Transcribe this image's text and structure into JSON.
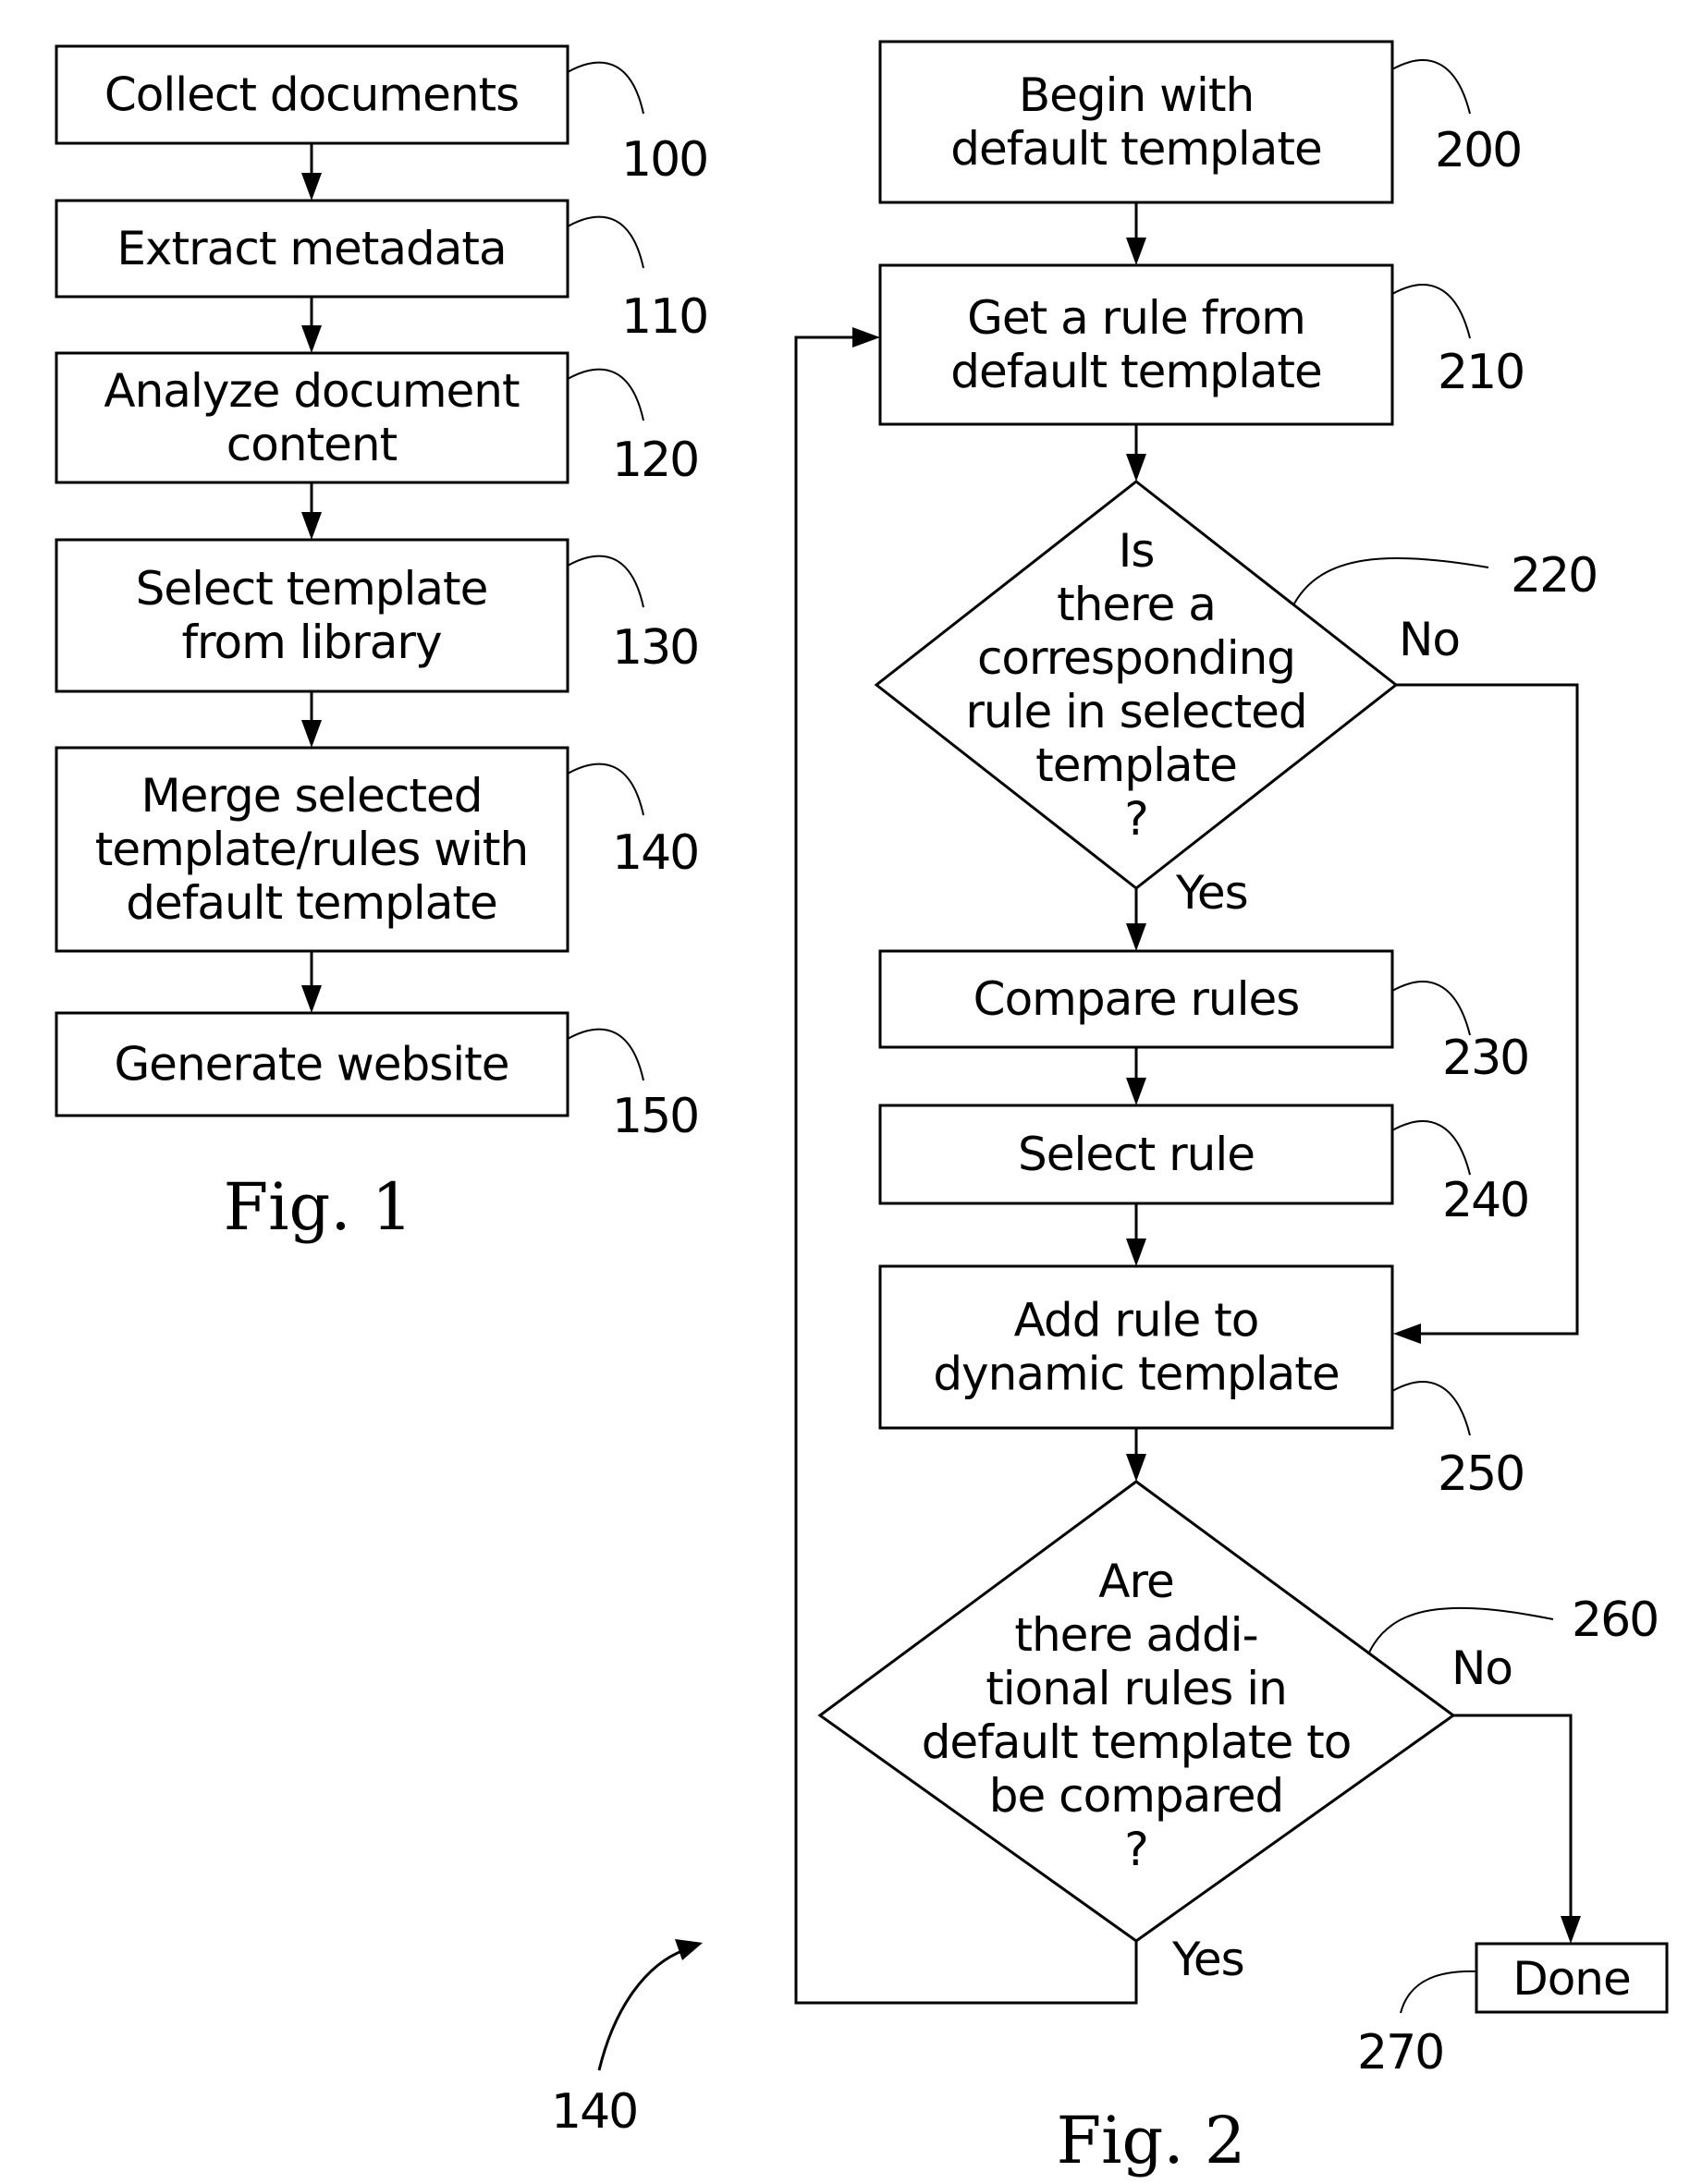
{
  "figure1": {
    "caption": "Fig. 1",
    "steps": [
      {
        "ref": "100",
        "lines": [
          "Collect documents"
        ]
      },
      {
        "ref": "110",
        "lines": [
          "Extract metadata"
        ]
      },
      {
        "ref": "120",
        "lines": [
          "Analyze document",
          "content"
        ]
      },
      {
        "ref": "130",
        "lines": [
          "Select template",
          "from library"
        ]
      },
      {
        "ref": "140",
        "lines": [
          "Merge selected",
          "template/rules with",
          "default template"
        ]
      },
      {
        "ref": "150",
        "lines": [
          "Generate website"
        ]
      }
    ]
  },
  "figure2": {
    "caption": "Fig. 2",
    "overall_ref": "140",
    "nodes": {
      "n200": {
        "ref": "200",
        "type": "process",
        "lines": [
          "Begin with",
          "default template"
        ]
      },
      "n210": {
        "ref": "210",
        "type": "process",
        "lines": [
          "Get a rule from",
          "default template"
        ]
      },
      "n220": {
        "ref": "220",
        "type": "decision",
        "lines": [
          "Is",
          "there a",
          "corresponding",
          "rule in selected",
          "template",
          "?"
        ]
      },
      "n230": {
        "ref": "230",
        "type": "process",
        "lines": [
          "Compare rules"
        ]
      },
      "n240": {
        "ref": "240",
        "type": "process",
        "lines": [
          "Select rule"
        ]
      },
      "n250": {
        "ref": "250",
        "type": "process",
        "lines": [
          "Add rule to",
          "dynamic template"
        ]
      },
      "n260": {
        "ref": "260",
        "type": "decision",
        "lines": [
          "Are",
          "there addi-",
          "tional rules in",
          "default template to",
          "be compared",
          "?"
        ]
      },
      "n270": {
        "ref": "270",
        "type": "terminal",
        "lines": [
          "Done"
        ]
      }
    },
    "branches": {
      "d220_yes": "Yes",
      "d220_no": "No",
      "d260_yes": "Yes",
      "d260_no": "No"
    }
  }
}
